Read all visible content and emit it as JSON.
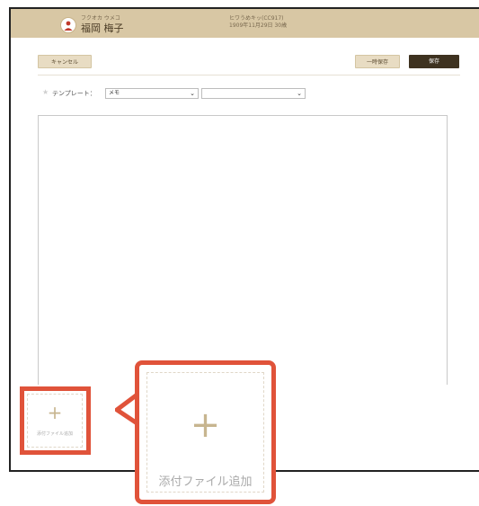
{
  "header": {
    "kana": "フクオカ ウメコ",
    "name": "福岡 梅子",
    "patient_id": "ヒワうめキッ(CC917)",
    "birth_info": "1909年11月29日 30歳"
  },
  "toolbar": {
    "cancel_label": "キャンセル",
    "temp_save_label": "一時保存",
    "save_label": "保存"
  },
  "template": {
    "label": "テンプレート：",
    "selected_value": "メモ",
    "secondary_value": ""
  },
  "attachment": {
    "add_label": "添付ファイル追加",
    "callout_label": "添付ファイル追加"
  },
  "colors": {
    "header_bg": "#d8c7a4",
    "highlight": "#e0533a",
    "save_bg": "#3e3220"
  }
}
